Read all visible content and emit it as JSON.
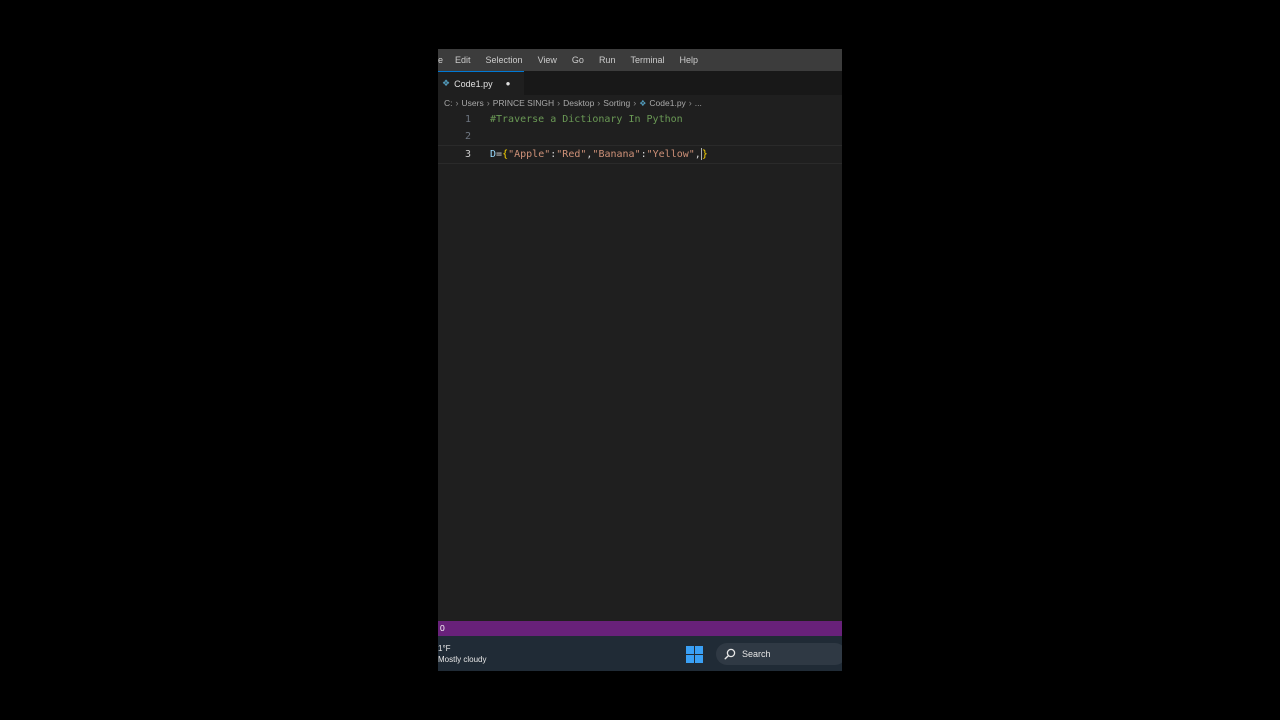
{
  "menubar": {
    "items": [
      "e",
      "Edit",
      "Selection",
      "View",
      "Go",
      "Run",
      "Terminal",
      "Help"
    ]
  },
  "tab": {
    "filename": "Code1.py",
    "dirty_marker": "●"
  },
  "breadcrumb": {
    "parts": [
      "C:",
      "Users",
      "PRINCE SINGH",
      "Desktop",
      "Sorting",
      "Code1.py",
      "..."
    ]
  },
  "code": {
    "line1": {
      "num": "1",
      "text": "#Traverse a Dictionary In Python"
    },
    "line2": {
      "num": "2",
      "text": ""
    },
    "line3": {
      "num": "3",
      "var": "D",
      "eq": "=",
      "open": "{",
      "k1": "\"Apple\"",
      "c1": ":",
      "v1": "\"Red\"",
      "sep1": ",",
      "k2": "\"Banana\"",
      "c2": ":",
      "v2": "\"Yellow\"",
      "sep2": ",",
      "close": "}"
    }
  },
  "statusbar": {
    "text": "0"
  },
  "taskbar": {
    "temp": "1°F",
    "weather": "Mostly cloudy",
    "search_label": "Search"
  },
  "colors": {
    "status_bg": "#68217a",
    "accent": "#0078d4",
    "comment": "#6a9955",
    "string": "#ce9178",
    "brace": "#ffd700"
  }
}
